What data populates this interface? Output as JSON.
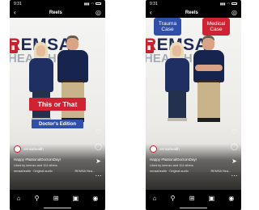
{
  "phones": [
    {
      "status": {
        "time": "9:31",
        "icons": [
          "signal-icon",
          "wifi-icon",
          "battery-icon"
        ]
      },
      "header": {
        "back_icon": "chevron-left-icon",
        "title": "Reels",
        "camera_icon": "camera-icon"
      },
      "overlay": {
        "title": "This or That",
        "subtitle": "Doctor's Edition"
      },
      "account": {
        "name": "remsahealth"
      },
      "caption": {
        "text": "Happy #NationalDoctorsDay!",
        "likes": "Liked by lorenzo and 114 others",
        "audio": "remsahealth · Original audio",
        "location": "REMSA Hea..."
      },
      "rail_icons": [
        "heart-icon",
        "comment-icon",
        "share-icon",
        "more-icon"
      ],
      "nav_icons": [
        "home-icon",
        "search-icon",
        "add-post-icon",
        "reels-icon",
        "profile-icon"
      ]
    },
    {
      "status": {
        "time": "9:31",
        "icons": [
          "signal-icon",
          "wifi-icon",
          "battery-icon"
        ]
      },
      "header": {
        "back_icon": "chevron-left-icon",
        "title": "Reels",
        "camera_icon": "camera-icon"
      },
      "tags": [
        {
          "line1": "Trauma",
          "line2": "Case",
          "color": "#2f4fa8"
        },
        {
          "line1": "Medical",
          "line2": "Case",
          "color": "#cf2232"
        }
      ],
      "account": {
        "name": "remsahealth"
      },
      "caption": {
        "text": "Happy #NationalDoctorsDay!",
        "likes": "Liked by lorenzo and 114 others",
        "audio": "remsahealth · Original audio",
        "location": "REMSA Hea..."
      },
      "rail_icons": [
        "heart-icon",
        "comment-icon",
        "share-icon",
        "more-icon"
      ],
      "nav_icons": [
        "home-icon",
        "search-icon",
        "add-post-icon",
        "reels-icon",
        "profile-icon"
      ]
    }
  ],
  "backdrop": {
    "brand_part1": "R",
    "brand_part2": "EMSA",
    "brand_line2": "HEALTH"
  },
  "colors": {
    "brand_red": "#cf2232",
    "brand_blue": "#2f4fa8",
    "navy": "#1d2a55"
  }
}
